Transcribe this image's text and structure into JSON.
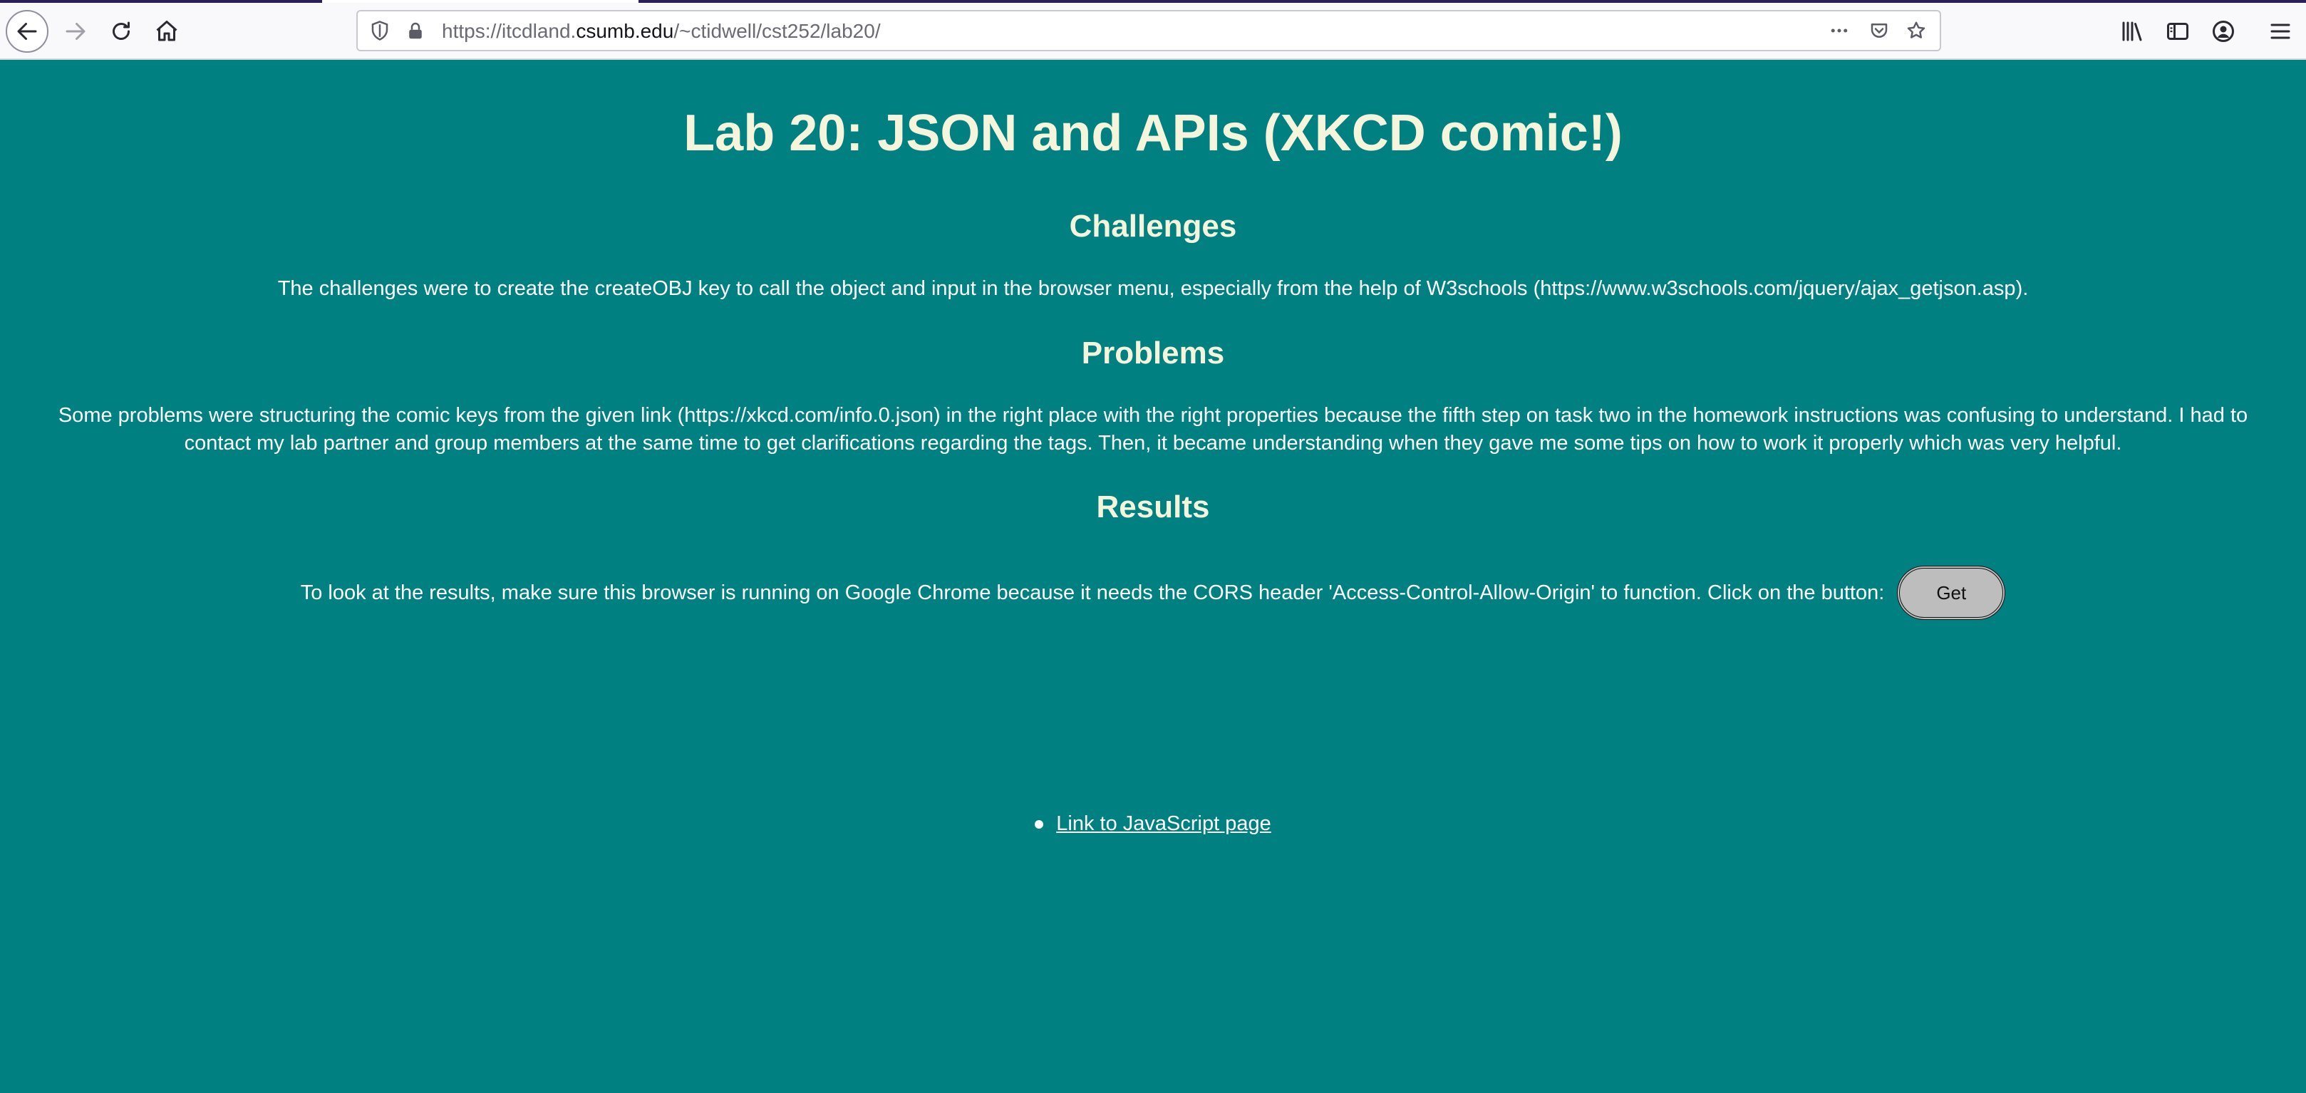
{
  "browser": {
    "url_prefix": "https://itcdland.",
    "url_host": "csumb.edu",
    "url_path": "/~ctidwell/cst252/lab20/"
  },
  "page": {
    "title": "Lab 20: JSON and APIs (XKCD comic!)",
    "sections": {
      "challenges": {
        "heading": "Challenges",
        "text": "The challenges were to create the createOBJ key to call the object and input in the browser menu, especially from the help of W3schools (https://www.w3schools.com/jquery/ajax_getjson.asp)."
      },
      "problems": {
        "heading": "Problems",
        "text": "Some problems were structuring the comic keys from the given link (https://xkcd.com/info.0.json) in the right place with the right properties because the fifth step on task two in the homework instructions was confusing to understand. I had to contact my lab partner and group members at the same time to get clarifications regarding the tags. Then, it became understanding when they gave me some tips on how to work it properly which was very helpful."
      },
      "results": {
        "heading": "Results",
        "text": "To look at the results, make sure this browser is running on Google Chrome because it needs the CORS header 'Access-Control-Allow-Origin' to function. Click on the button:",
        "button_label": "Get"
      }
    },
    "links": [
      {
        "label": "Link to JavaScript page"
      }
    ]
  },
  "colors": {
    "background": "#008080",
    "heading": "#f5f5dc",
    "text": "#ffffff",
    "button": "#bdbdbd"
  }
}
